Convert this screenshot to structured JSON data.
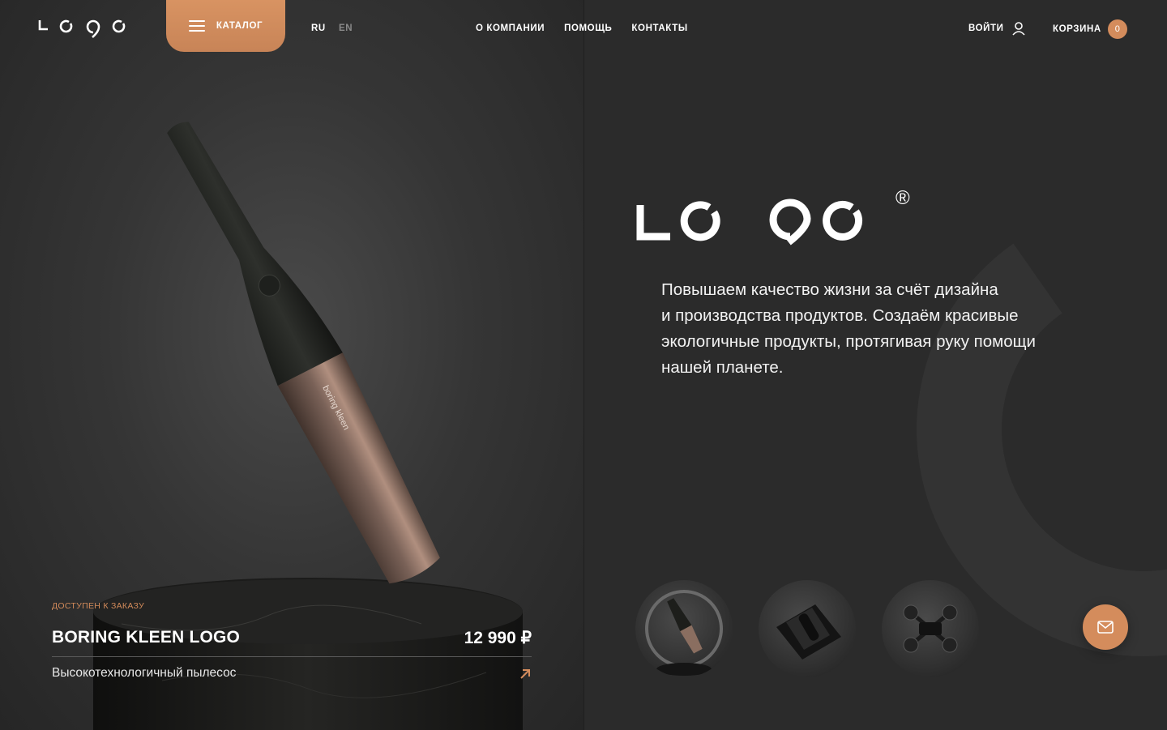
{
  "header": {
    "logo_alt": "logo",
    "catalog_label": "КАТАЛОГ",
    "lang_ru": "RU",
    "lang_en": "EN",
    "nav": [
      "О КОМПАНИИ",
      "ПОМОЩЬ",
      "КОНТАКТЫ"
    ],
    "login_label": "ВОЙТИ",
    "cart_label": "КОРЗИНА",
    "cart_count": "0"
  },
  "product": {
    "availability": "ДОСТУПЕН К ЗАКАЗУ",
    "name": "BORING KLEEN LOGO",
    "price": "12 990 ₽",
    "description": "Высокотехнологичный пылесос",
    "engraving": "boring kleen"
  },
  "hero": {
    "registered_mark": "®",
    "tagline_lines": [
      "Повышаем качество жизни за счёт дизайна",
      "и производства продуктов. Создаём красивые",
      "экологичные продукты, протягивая руку помощи",
      "нашей планете."
    ]
  },
  "thumbnails": [
    "vacuum-thumbnail",
    "bottle-box-thumbnail",
    "drone-thumbnail"
  ],
  "icons": {
    "menu": "menu-icon",
    "user": "user-icon",
    "mail": "mail-icon",
    "arrow": "arrow-up-right-icon"
  },
  "colors": {
    "accent": "#d48c5c",
    "background": "#2b2b2b"
  }
}
